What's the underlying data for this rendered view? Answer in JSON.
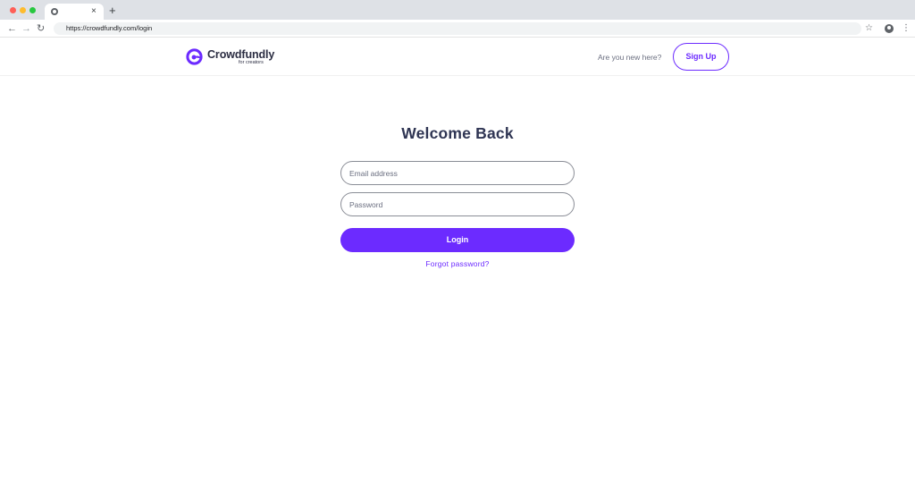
{
  "browser": {
    "url": "https://crowdfundly.com/login",
    "tab": {
      "favicon": "chrome-icon",
      "close_glyph": "×"
    },
    "new_tab_glyph": "+",
    "icons": {
      "back": "arrow-left-icon",
      "forward": "arrow-right-icon",
      "reload": "reload-icon",
      "bookmark": "star-icon",
      "profile": "profile-icon",
      "menu": "kebab-menu-icon"
    }
  },
  "header": {
    "brand": "Crowdfundly",
    "tagline": "for creators",
    "prompt": "Are you new here?",
    "signup_label": "Sign Up"
  },
  "login": {
    "title": "Welcome Back",
    "email_placeholder": "Email address",
    "password_placeholder": "Password",
    "submit_label": "Login",
    "forgot_label": "Forgot password?"
  },
  "colors": {
    "accent": "#6c2bff",
    "heading": "#2f3553",
    "muted": "#6b6f80"
  }
}
